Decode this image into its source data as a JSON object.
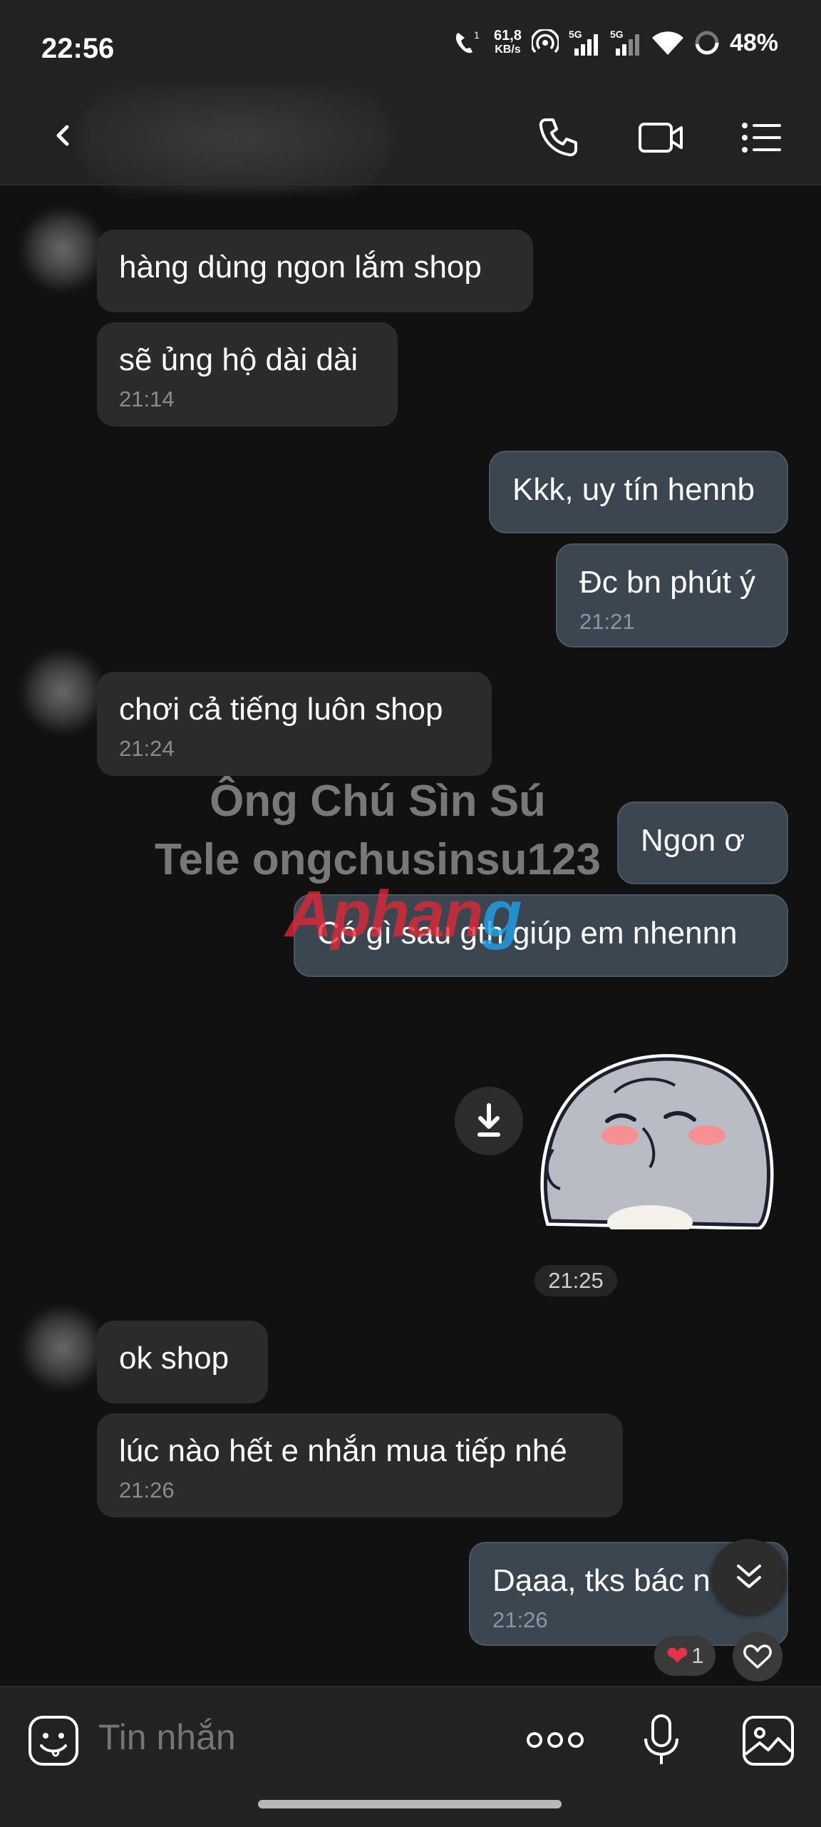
{
  "status_bar": {
    "time": "22:56",
    "net_speed_value": "61,8",
    "net_speed_unit": "KB/s",
    "signal_1": "5G",
    "signal_2": "5G",
    "call_sim": "1",
    "battery": "48%"
  },
  "header": {
    "icons": [
      "back-icon",
      "phone-icon",
      "video-call-icon",
      "menu-icon"
    ]
  },
  "messages": [
    {
      "side": "in",
      "text": "hàng dùng ngon lắm shop"
    },
    {
      "side": "in",
      "text": "sẽ ủng hộ dài dài",
      "time": "21:14"
    },
    {
      "side": "out",
      "text": "Kkk, uy tín hennb"
    },
    {
      "side": "out",
      "text": "Đc bn phút ý",
      "time": "21:21"
    },
    {
      "side": "in",
      "text": "chơi cả tiếng luôn shop",
      "time": "21:24"
    },
    {
      "side": "out",
      "text": "Ngon ơ"
    },
    {
      "side": "out",
      "text": "Có gì sau gth giúp em nhennn"
    },
    {
      "side": "out",
      "type": "sticker"
    },
    {
      "side": "in",
      "text": "ok shop"
    },
    {
      "side": "in",
      "text": "lúc nào hết e nhắn mua tiếp nhé",
      "time": "21:26"
    },
    {
      "side": "out",
      "text": "Dạaa, tks bác n",
      "time": "21:26"
    }
  ],
  "sticker_time": "21:25",
  "reaction": {
    "emoji": "❤",
    "count": "1"
  },
  "watermark": {
    "line1": "Ông Chú Sìn Sú",
    "line2": "Tele ongchusinsu123",
    "logo_part1": "Aphan",
    "logo_part2": "g"
  },
  "input": {
    "placeholder": "Tin nhắn",
    "icons": [
      "sticker-icon",
      "more-icon",
      "microphone-icon",
      "gallery-icon"
    ]
  },
  "colors": {
    "background": "#111111",
    "incoming_bubble": "#2b2b2b",
    "outgoing_bubble": "#3b4651",
    "bars": "#222222"
  }
}
